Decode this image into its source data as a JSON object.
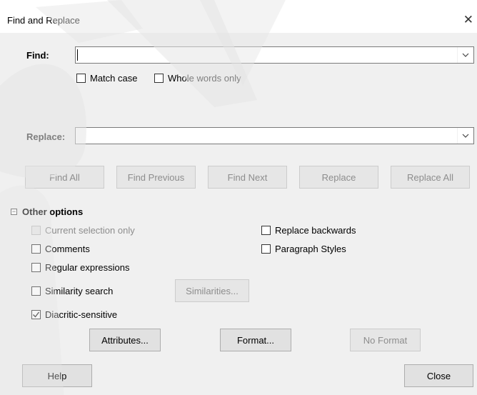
{
  "window": {
    "title": "Find and Replace",
    "close_glyph": "✕"
  },
  "find": {
    "label": "Find:",
    "value": "",
    "match_case": {
      "label": "Match case",
      "checked": false
    },
    "whole_words": {
      "label": "Whole words only",
      "checked": false
    }
  },
  "replace": {
    "label": "Replace:",
    "value": ""
  },
  "actions": {
    "find_all": "Find All",
    "find_previous": "Find Previous",
    "find_next": "Find Next",
    "replace": "Replace",
    "replace_all": "Replace All"
  },
  "other_options": {
    "header": "Other options",
    "expander_glyph": "−",
    "current_selection_only": {
      "label": "Current selection only",
      "checked": false,
      "enabled": false
    },
    "comments": {
      "label": "Comments",
      "checked": false
    },
    "regular_expressions": {
      "label": "Regular expressions",
      "checked": false
    },
    "similarity_search": {
      "label": "Similarity search",
      "checked": false
    },
    "similarities_button": "Similarities...",
    "diacritic_sensitive": {
      "label": "Diacritic-sensitive",
      "checked": true
    },
    "replace_backwards": {
      "label": "Replace backwards",
      "checked": false
    },
    "paragraph_styles": {
      "label": "Paragraph Styles",
      "checked": false
    },
    "attributes_button": "Attributes...",
    "format_button": "Format...",
    "no_format_button": "No Format"
  },
  "footer": {
    "help": "Help",
    "close": "Close"
  },
  "colors": {
    "dialog_bg": "#f0f0f0",
    "button_bg": "#e1e1e1",
    "disabled_text": "#8d8d8d"
  }
}
